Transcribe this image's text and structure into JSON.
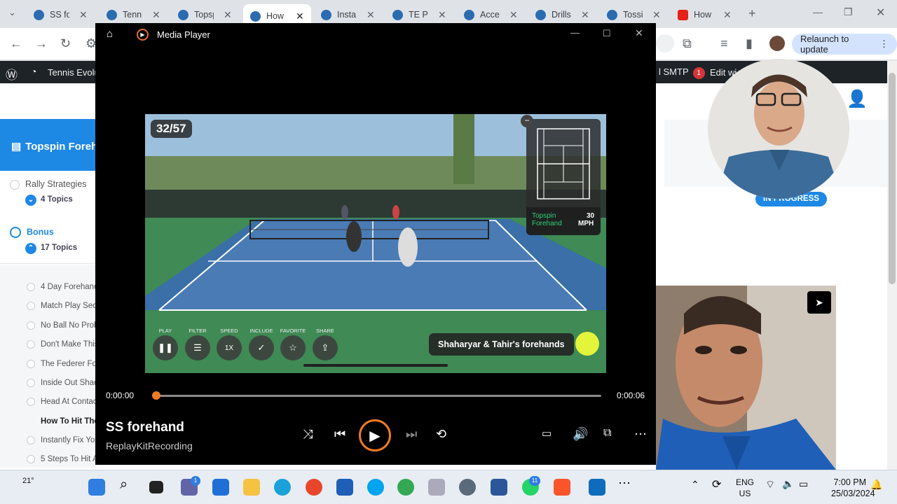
{
  "browser": {
    "tabs": [
      {
        "label": "SS for"
      },
      {
        "label": "Tenni"
      },
      {
        "label": "Topsp"
      },
      {
        "label": "How T",
        "active": true
      },
      {
        "label": "Instan"
      },
      {
        "label": "TE Plu"
      },
      {
        "label": "Accel"
      },
      {
        "label": "Drills"
      },
      {
        "label": "Tossir"
      },
      {
        "label": "How",
        "icon": "youtube-icon"
      }
    ],
    "relaunch_label": "Relaunch to update"
  },
  "wp_admin_bar": {
    "site_name": "Tennis Evolu",
    "smtp_label": "l SMTP",
    "smtp_badge": "1",
    "edit_label": "Edit wi"
  },
  "course": {
    "lesson_banner": "Topspin Forehand",
    "sections": [
      {
        "label": "Rally Strategies",
        "topics": "4 Topics"
      },
      {
        "label": "Bonus",
        "topics": "17 Topics"
      }
    ],
    "lessons": [
      "4 Day Forehand",
      "Match Play Secr",
      "No Ball No Prob",
      "Don't Make This",
      "The Federer For",
      "Inside Out Shad",
      "Head At Contac",
      "How To Hit The",
      "Instantly Fix You",
      "5 Steps To Hit A"
    ],
    "status_badge": "IN PROGRESS"
  },
  "media_player": {
    "app_title": "Media Player",
    "clip_counter": "32/57",
    "shot_type": "Topspin Forehand",
    "shot_speed_value": "30",
    "shot_speed_unit": "MPH",
    "controls": [
      {
        "label": "PLAY",
        "icon": "pause-icon"
      },
      {
        "label": "FILTER",
        "icon": "sliders-icon"
      },
      {
        "label": "SPEED",
        "value": "1X"
      },
      {
        "label": "INCLUDE",
        "icon": "check-icon"
      },
      {
        "label": "FAVORITE",
        "icon": "star-icon"
      },
      {
        "label": "SHARE",
        "icon": "share-icon"
      }
    ],
    "caption": "Shaharyar & Tahir's forehands",
    "time_current": "0:00:00",
    "time_total": "0:00:06",
    "progress": 0.0,
    "track_title": "SS forehand",
    "track_subtitle": "ReplayKitRecording"
  },
  "taskbar": {
    "weather_temp": "21°",
    "chat_badge": "1",
    "whatsapp_badge": "11",
    "lang_1": "ENG",
    "lang_2": "US",
    "time": "7:00 PM",
    "date": "25/03/2024"
  },
  "colors": {
    "accent_orange": "#f07b22",
    "lms_blue": "#1e88e5",
    "wp_bar": "#1d2327"
  }
}
